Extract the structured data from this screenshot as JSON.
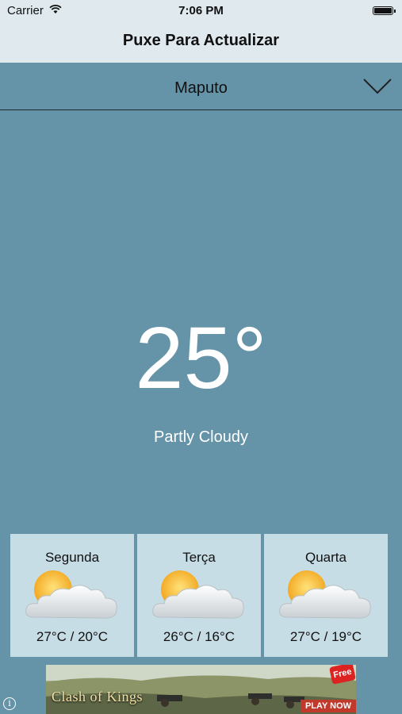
{
  "status_bar": {
    "carrier": "Carrier",
    "time": "7:06 PM"
  },
  "nav": {
    "title": "Puxe Para Actualizar"
  },
  "city": {
    "name": "Maputo"
  },
  "current": {
    "temperature": "25°",
    "condition": "Partly Cloudy"
  },
  "forecast": [
    {
      "day": "Segunda",
      "range": "27°C / 20°C",
      "icon": "partly-cloudy-icon"
    },
    {
      "day": "Terça",
      "range": "26°C / 16°C",
      "icon": "partly-cloudy-icon"
    },
    {
      "day": "Quarta",
      "range": "27°C / 19°C",
      "icon": "partly-cloudy-icon"
    }
  ],
  "ad": {
    "title": "Clash of Kings",
    "badge": "Free",
    "cta": "PLAY NOW"
  },
  "colors": {
    "background": "#6593a8",
    "nav_bar": "#dfe9ee",
    "card": "#c7dde6"
  }
}
